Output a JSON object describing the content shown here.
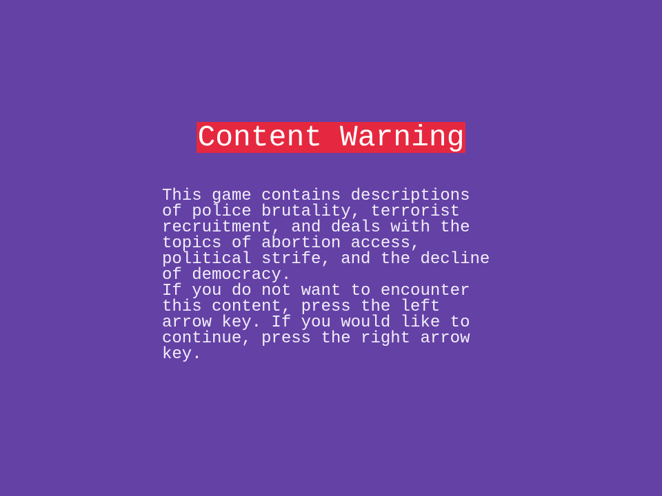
{
  "screen": {
    "title": "Content Warning",
    "lines": [
      "This game contains descriptions",
      "of police brutality, terrorist",
      "recruitment, and deals with the",
      "topics of abortion access,",
      "political strife, and the decline",
      "of democracy.",
      "If you do not want to encounter",
      "this content, press the left",
      "arrow key. If you would like to",
      "continue, press the right arrow",
      "key."
    ]
  },
  "colors": {
    "background": "#6441a5",
    "title_highlight": "#e5283f",
    "title_text": "#ffffff",
    "body_text": "#f1eefb"
  }
}
